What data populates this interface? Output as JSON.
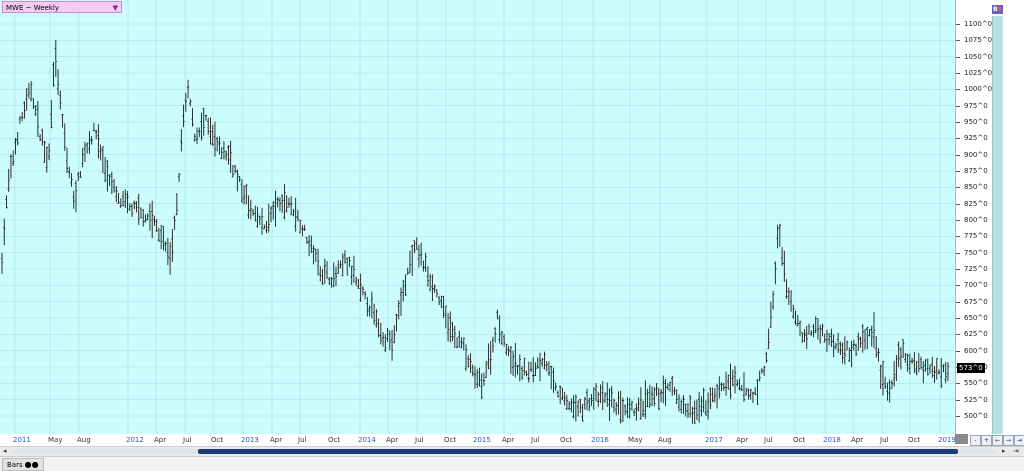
{
  "symbol_selector": {
    "label": "MWE ~ Weekly",
    "arrow": "▼"
  },
  "bs_button": {
    "b": "B",
    "s": "S"
  },
  "last_price": "573^0",
  "bottom_tab": {
    "label": "Bars",
    "dots": "●●"
  },
  "scroll": {
    "left": "◂",
    "right": "▸",
    "end": "⇥"
  },
  "zoom_buttons": [
    "-",
    "+",
    "←",
    "→",
    "⇥"
  ],
  "colors": {
    "background": "#ccfcfd",
    "bars": "#1a1a1a",
    "grid": "#a8e2e4",
    "year_label": "#2a56c6"
  },
  "chart_data": {
    "type": "ohlc-bar",
    "title": "MWE ~ Weekly",
    "ylim": [
      485,
      1125
    ],
    "y_ticks": [
      "1100^0",
      "1075^0",
      "1050^0",
      "1025^0",
      "1000^0",
      "975^0",
      "950^0",
      "925^0",
      "900^0",
      "875^0",
      "850^0",
      "825^0",
      "800^0",
      "775^0",
      "750^0",
      "725^0",
      "700^0",
      "675^0",
      "650^0",
      "625^0",
      "600^0",
      "575^0",
      "550^0",
      "525^0",
      "500^0"
    ],
    "x_labels": [
      {
        "text": "2011",
        "kind": "year"
      },
      {
        "text": "May",
        "kind": "month"
      },
      {
        "text": "Aug",
        "kind": "month"
      },
      {
        "text": "2012",
        "kind": "year"
      },
      {
        "text": "Apr",
        "kind": "month"
      },
      {
        "text": "Jul",
        "kind": "month"
      },
      {
        "text": "Oct",
        "kind": "month"
      },
      {
        "text": "2013",
        "kind": "year"
      },
      {
        "text": "Apr",
        "kind": "month"
      },
      {
        "text": "Jul",
        "kind": "month"
      },
      {
        "text": "Oct",
        "kind": "month"
      },
      {
        "text": "2014",
        "kind": "year"
      },
      {
        "text": "Apr",
        "kind": "month"
      },
      {
        "text": "Jul",
        "kind": "month"
      },
      {
        "text": "Oct",
        "kind": "month"
      },
      {
        "text": "2015",
        "kind": "year"
      },
      {
        "text": "Apr",
        "kind": "month"
      },
      {
        "text": "Jul",
        "kind": "month"
      },
      {
        "text": "Oct",
        "kind": "month"
      },
      {
        "text": "2016",
        "kind": "year"
      },
      {
        "text": "May",
        "kind": "month"
      },
      {
        "text": "Aug",
        "kind": "month"
      },
      {
        "text": "2017",
        "kind": "year"
      },
      {
        "text": "Apr",
        "kind": "month"
      },
      {
        "text": "Jul",
        "kind": "month"
      },
      {
        "text": "Oct",
        "kind": "month"
      },
      {
        "text": "2018",
        "kind": "year"
      },
      {
        "text": "Apr",
        "kind": "month"
      },
      {
        "text": "Jul",
        "kind": "month"
      },
      {
        "text": "Oct",
        "kind": "month"
      },
      {
        "text": "2019",
        "kind": "year"
      }
    ],
    "price_path": [
      [
        2011.0,
        740
      ],
      [
        2011.05,
        850
      ],
      [
        2011.15,
        945
      ],
      [
        2011.25,
        1000
      ],
      [
        2011.33,
        930
      ],
      [
        2011.4,
        890
      ],
      [
        2011.45,
        1060
      ],
      [
        2011.55,
        900
      ],
      [
        2011.62,
        830
      ],
      [
        2011.7,
        900
      ],
      [
        2011.8,
        940
      ],
      [
        2011.88,
        880
      ],
      [
        2012.0,
        830
      ],
      [
        2012.1,
        820
      ],
      [
        2012.2,
        810
      ],
      [
        2012.3,
        800
      ],
      [
        2012.4,
        760
      ],
      [
        2012.45,
        740
      ],
      [
        2012.5,
        820
      ],
      [
        2012.55,
        950
      ],
      [
        2012.6,
        1000
      ],
      [
        2012.65,
        930
      ],
      [
        2012.75,
        950
      ],
      [
        2012.85,
        910
      ],
      [
        2012.95,
        900
      ],
      [
        2013.05,
        850
      ],
      [
        2013.15,
        810
      ],
      [
        2013.25,
        790
      ],
      [
        2013.35,
        820
      ],
      [
        2013.45,
        830
      ],
      [
        2013.55,
        800
      ],
      [
        2013.65,
        760
      ],
      [
        2013.75,
        720
      ],
      [
        2013.85,
        710
      ],
      [
        2013.95,
        740
      ],
      [
        2014.05,
        700
      ],
      [
        2014.15,
        670
      ],
      [
        2014.25,
        630
      ],
      [
        2014.35,
        610
      ],
      [
        2014.45,
        700
      ],
      [
        2014.55,
        760
      ],
      [
        2014.65,
        720
      ],
      [
        2014.75,
        680
      ],
      [
        2014.85,
        630
      ],
      [
        2014.95,
        610
      ],
      [
        2015.05,
        560
      ],
      [
        2015.12,
        550
      ],
      [
        2015.2,
        600
      ],
      [
        2015.25,
        650
      ],
      [
        2015.35,
        590
      ],
      [
        2015.45,
        570
      ],
      [
        2015.55,
        570
      ],
      [
        2015.65,
        590
      ],
      [
        2015.75,
        540
      ],
      [
        2015.85,
        520
      ],
      [
        2015.95,
        510
      ],
      [
        2016.05,
        525
      ],
      [
        2016.15,
        530
      ],
      [
        2016.25,
        520
      ],
      [
        2016.35,
        505
      ],
      [
        2016.45,
        510
      ],
      [
        2016.55,
        525
      ],
      [
        2016.65,
        535
      ],
      [
        2016.75,
        545
      ],
      [
        2016.85,
        510
      ],
      [
        2016.95,
        505
      ],
      [
        2017.05,
        520
      ],
      [
        2017.15,
        540
      ],
      [
        2017.25,
        555
      ],
      [
        2017.35,
        540
      ],
      [
        2017.45,
        530
      ],
      [
        2017.55,
        580
      ],
      [
        2017.62,
        680
      ],
      [
        2017.66,
        790
      ],
      [
        2017.7,
        730
      ],
      [
        2017.78,
        660
      ],
      [
        2017.88,
        620
      ],
      [
        2017.98,
        635
      ],
      [
        2018.08,
        620
      ],
      [
        2018.18,
        610
      ],
      [
        2018.28,
        600
      ],
      [
        2018.38,
        615
      ],
      [
        2018.48,
        630
      ],
      [
        2018.55,
        560
      ],
      [
        2018.62,
        530
      ],
      [
        2018.7,
        600
      ],
      [
        2018.78,
        580
      ],
      [
        2018.86,
        580
      ],
      [
        2018.94,
        575
      ],
      [
        2019.0,
        565
      ],
      [
        2019.07,
        575
      ],
      [
        2019.12,
        573
      ]
    ]
  }
}
